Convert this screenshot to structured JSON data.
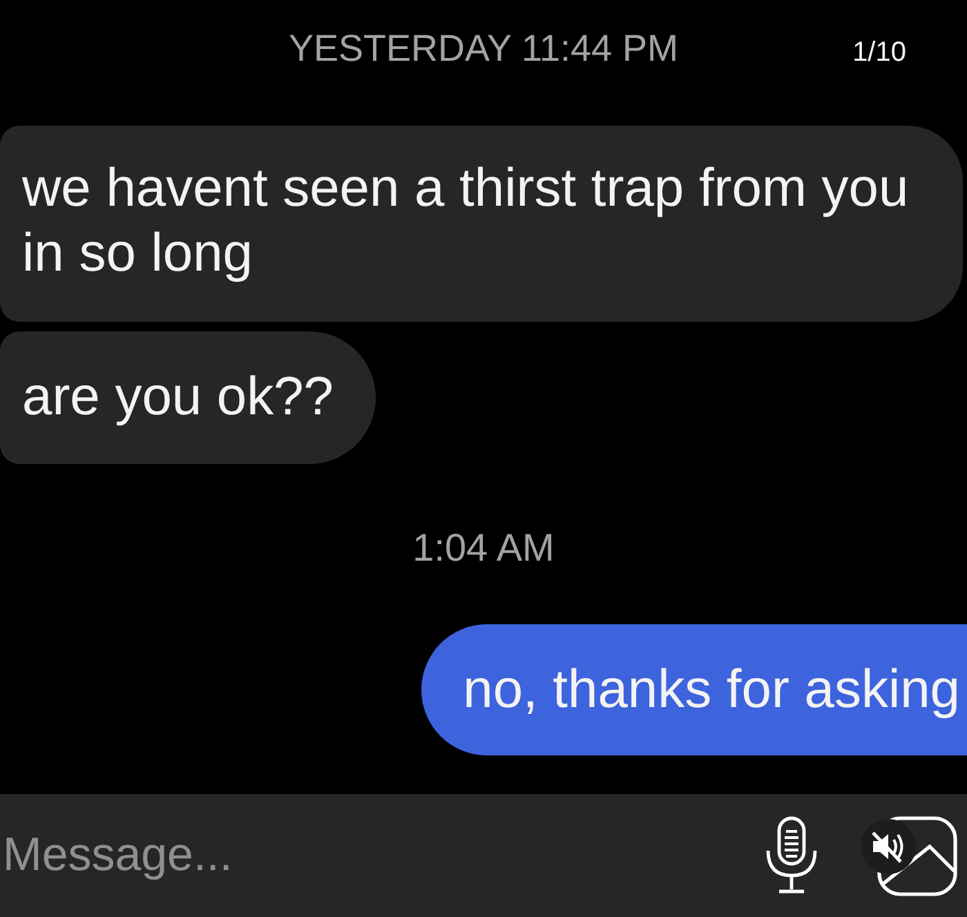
{
  "header": {
    "timestamp": "YESTERDAY 11:44 PM",
    "counter": "1/10"
  },
  "messages": [
    {
      "kind": "received",
      "text": "we havent seen a thirst trap from you in so long"
    },
    {
      "kind": "received",
      "text": "are you ok??"
    },
    {
      "kind": "timestamp",
      "text": "1:04 AM"
    },
    {
      "kind": "sent",
      "text": "no, thanks for asking"
    }
  ],
  "composer": {
    "placeholder": "Message..."
  }
}
